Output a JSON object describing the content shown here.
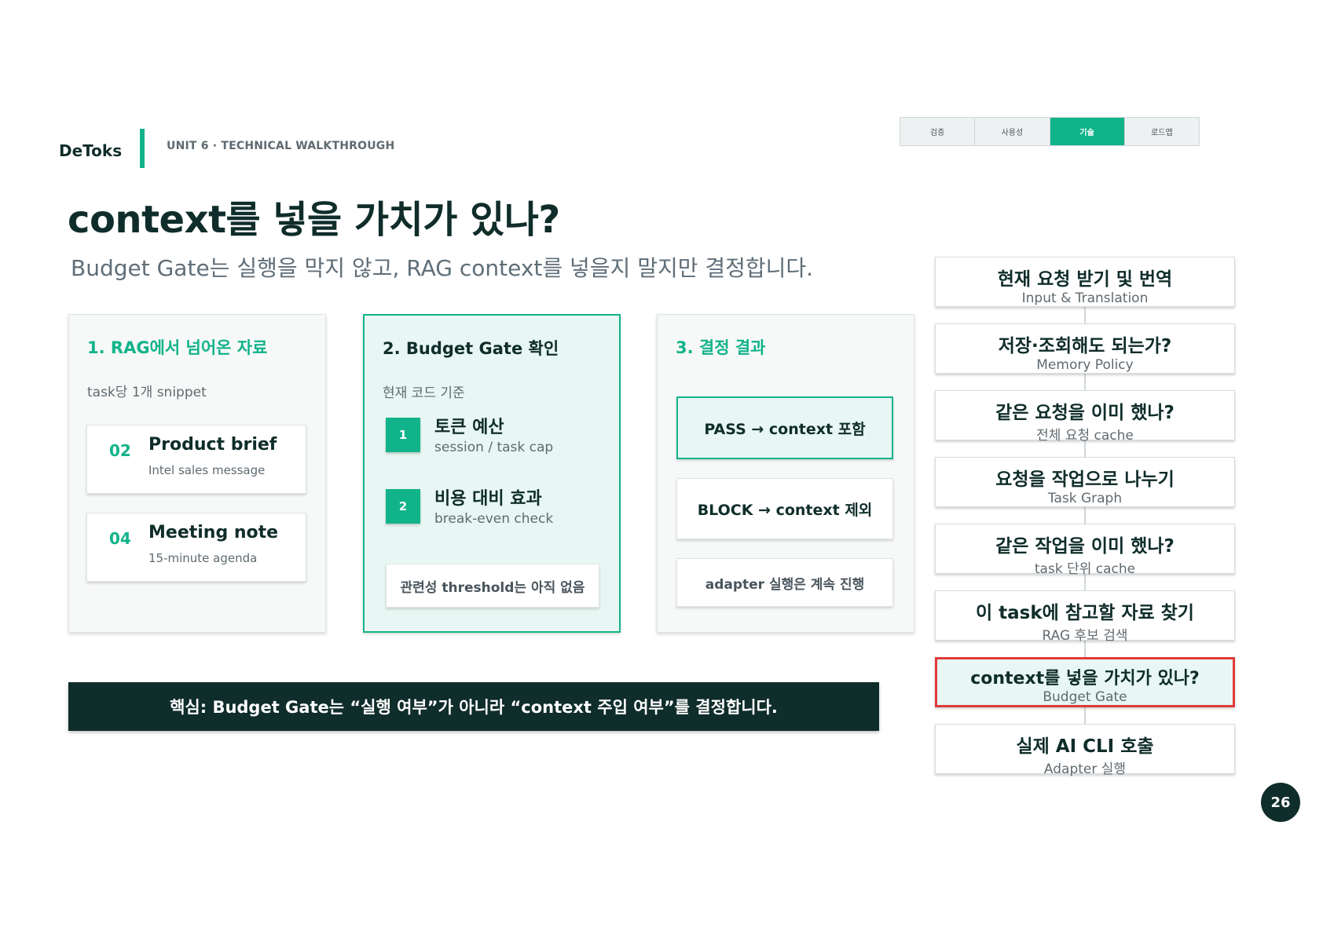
{
  "header": {
    "brand": "DeToks",
    "unit": "UNIT 6 · TECHNICAL WALKTHROUGH",
    "nav_tabs": [
      {
        "label": "검증",
        "active": false
      },
      {
        "label": "사용성",
        "active": false
      },
      {
        "label": "기술",
        "active": true
      },
      {
        "label": "로드맵",
        "active": false
      }
    ]
  },
  "title": "context를 넣을 가치가 있나?",
  "subtitle": "Budget Gate는 실행을 막지 않고, RAG context를 넣을지 말지만 결정합니다.",
  "card1": {
    "title": "1. RAG에서 넘어온 자료",
    "subtitle": "task당 1개 snippet",
    "items": [
      {
        "num": "02",
        "title": "Product brief",
        "desc": "Intel sales message"
      },
      {
        "num": "04",
        "title": "Meeting note",
        "desc": "15-minute agenda"
      }
    ]
  },
  "card2": {
    "title": "2. Budget Gate 확인",
    "subtitle": "현재 코드 기준",
    "steps": [
      {
        "num": "1",
        "title": "토큰 예산",
        "desc": "session / task cap"
      },
      {
        "num": "2",
        "title": "비용 대비 효과",
        "desc": "break-even check"
      }
    ],
    "note": "관련성 threshold는 아직 없음"
  },
  "card3": {
    "title": "3. 결정 결과",
    "pass": "PASS → context 포함",
    "block": "BLOCK → context 제외",
    "adapter": "adapter 실행은 계속 진행"
  },
  "banner": "핵심: Budget Gate는 “실행 여부”가 아니라 “context 주입 여부”를 결정합니다.",
  "flow": [
    {
      "title": "현재 요청 받기 및 번역",
      "sub": "Input & Translation",
      "active": false
    },
    {
      "title": "저장·조회해도 되는가?",
      "sub": "Memory Policy",
      "active": false
    },
    {
      "title": "같은 요청을 이미 했나?",
      "sub": "전체 요청 cache",
      "active": false
    },
    {
      "title": "요청을 작업으로 나누기",
      "sub": "Task Graph",
      "active": false
    },
    {
      "title": "같은 작업을 이미 했나?",
      "sub": "task 단위 cache",
      "active": false
    },
    {
      "title": "이 task에 참고할 자료 찾기",
      "sub": "RAG 후보 검색",
      "active": false
    },
    {
      "title": "context를 넣을 가치가 있나?",
      "sub": "Budget Gate",
      "active": true
    },
    {
      "title": "실제 AI CLI 호출",
      "sub": "Adapter 실행",
      "active": false
    }
  ],
  "page_number": "26",
  "colors": {
    "accent": "#11b38a",
    "dark": "#0f2d2a",
    "highlight_border": "#e03a3a"
  }
}
